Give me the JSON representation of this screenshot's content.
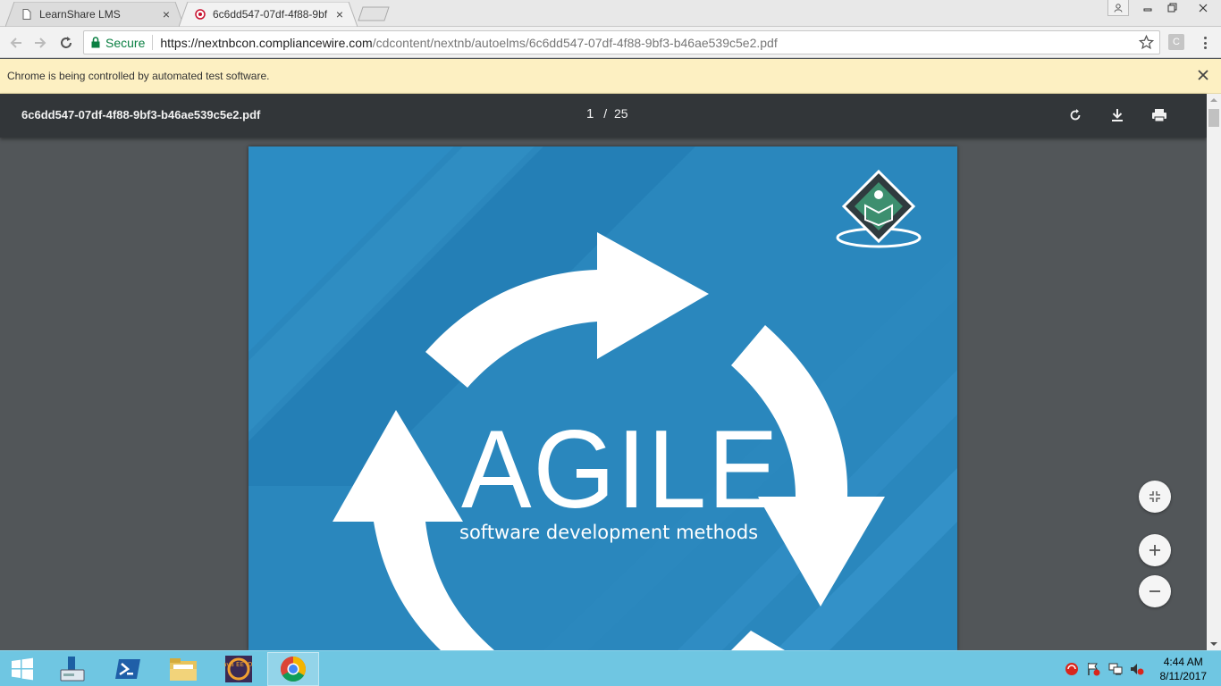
{
  "browser": {
    "tabs": [
      {
        "label": "LearnShare LMS",
        "close": "×"
      },
      {
        "label": "6c6dd547-07df-4f88-9bf",
        "close": "×"
      }
    ],
    "omnibox": {
      "secure_label": "Secure",
      "url_host": "https://nextnbcon.compliancewire.com",
      "url_path": "/cdcontent/nextnb/autoelms/6c6dd547-07df-4f88-9bf3-b46ae539c5e2.pdf"
    },
    "extension_label": "C",
    "infobar_text": "Chrome is being controlled by automated test software."
  },
  "pdf": {
    "filename": "6c6dd547-07df-4f88-9bf3-b46ae539c5e2.pdf",
    "current_page": "1",
    "separator": "/",
    "total_pages": "25",
    "cover": {
      "title": "AGILE",
      "subtitle": "software development methods"
    }
  },
  "taskbar": {
    "java_label": "Java EE IDE",
    "time": "4:44 AM",
    "date": "8/11/2017"
  },
  "colors": {
    "cover_bg": "#2a87bd",
    "infobar_bg": "#fdf0c2",
    "pdf_toolbar": "#323639",
    "taskbar": "#6fc6e2",
    "secure_green": "#0b8043"
  }
}
